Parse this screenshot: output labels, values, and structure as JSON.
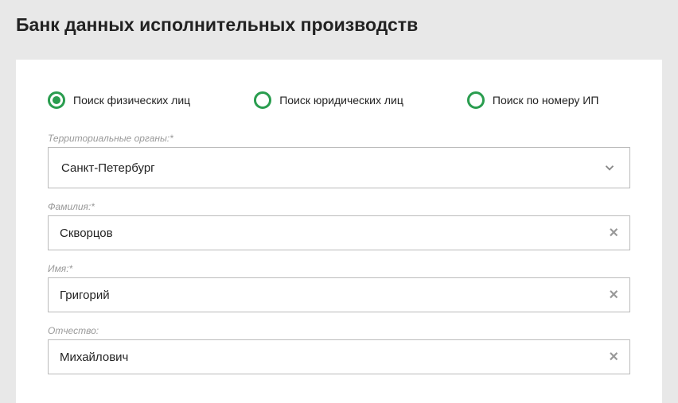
{
  "header": {
    "title": "Банк данных исполнительных производств"
  },
  "search_type": {
    "options": [
      {
        "label": "Поиск физических лиц",
        "selected": true
      },
      {
        "label": "Поиск юридических лиц",
        "selected": false
      },
      {
        "label": "Поиск по номеру ИП",
        "selected": false
      }
    ]
  },
  "fields": {
    "territory": {
      "label": "Территориальные органы:*",
      "value": "Санкт-Петербург"
    },
    "lastname": {
      "label": "Фамилия:*",
      "value": "Скворцов"
    },
    "firstname": {
      "label": "Имя:*",
      "value": "Григорий"
    },
    "patronymic": {
      "label": "Отчество:",
      "value": "Михайлович"
    }
  }
}
